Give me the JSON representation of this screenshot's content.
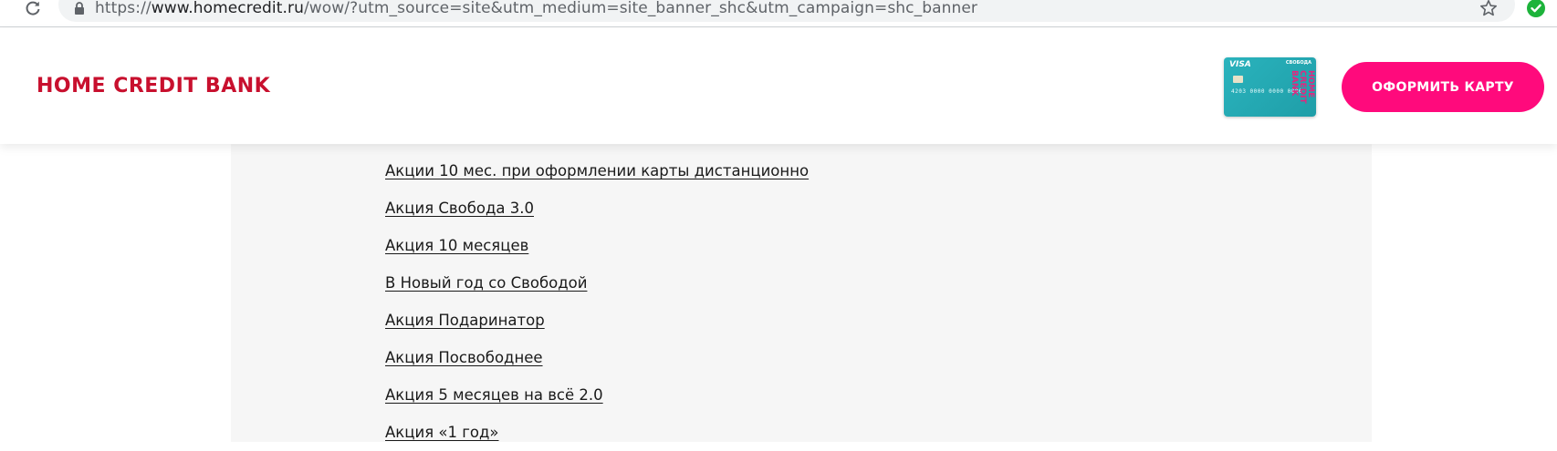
{
  "browser": {
    "url_scheme": "https://",
    "url_host": "www.homecredit.ru",
    "url_path": "/wow/?utm_source=site&utm_medium=site_banner_shc&utm_campaign=shc_banner",
    "icons": {
      "reload": "reload-icon",
      "lock": "lock-icon",
      "bookmark": "star-icon",
      "extension": "check-circle-icon"
    },
    "extension_color": "#1db33b"
  },
  "header": {
    "logo_text": "HOME CREDIT BANK",
    "logo_color": "#c8102e",
    "card": {
      "network": "VISA",
      "product": "СВОБОДА",
      "number": "4203 0000 0000 0000",
      "brand": "HOME CREDIT BANK",
      "color": "#2ab3bd"
    },
    "cta_label": "ОФОРМИТЬ КАРТУ",
    "cta_color": "#ff0a7c"
  },
  "promos": [
    {
      "label": "Акции 10 мес. при оформлении карты дистанционно"
    },
    {
      "label": "Акция Свобода 3.0"
    },
    {
      "label": "Акция 10 месяцев"
    },
    {
      "label": "В Новый год со Свободой"
    },
    {
      "label": "Акция Подаринатор"
    },
    {
      "label": "Акция Посвободнее"
    },
    {
      "label": "Акция 5 месяцев на всё 2.0"
    },
    {
      "label": "Акция «1 год»"
    }
  ]
}
